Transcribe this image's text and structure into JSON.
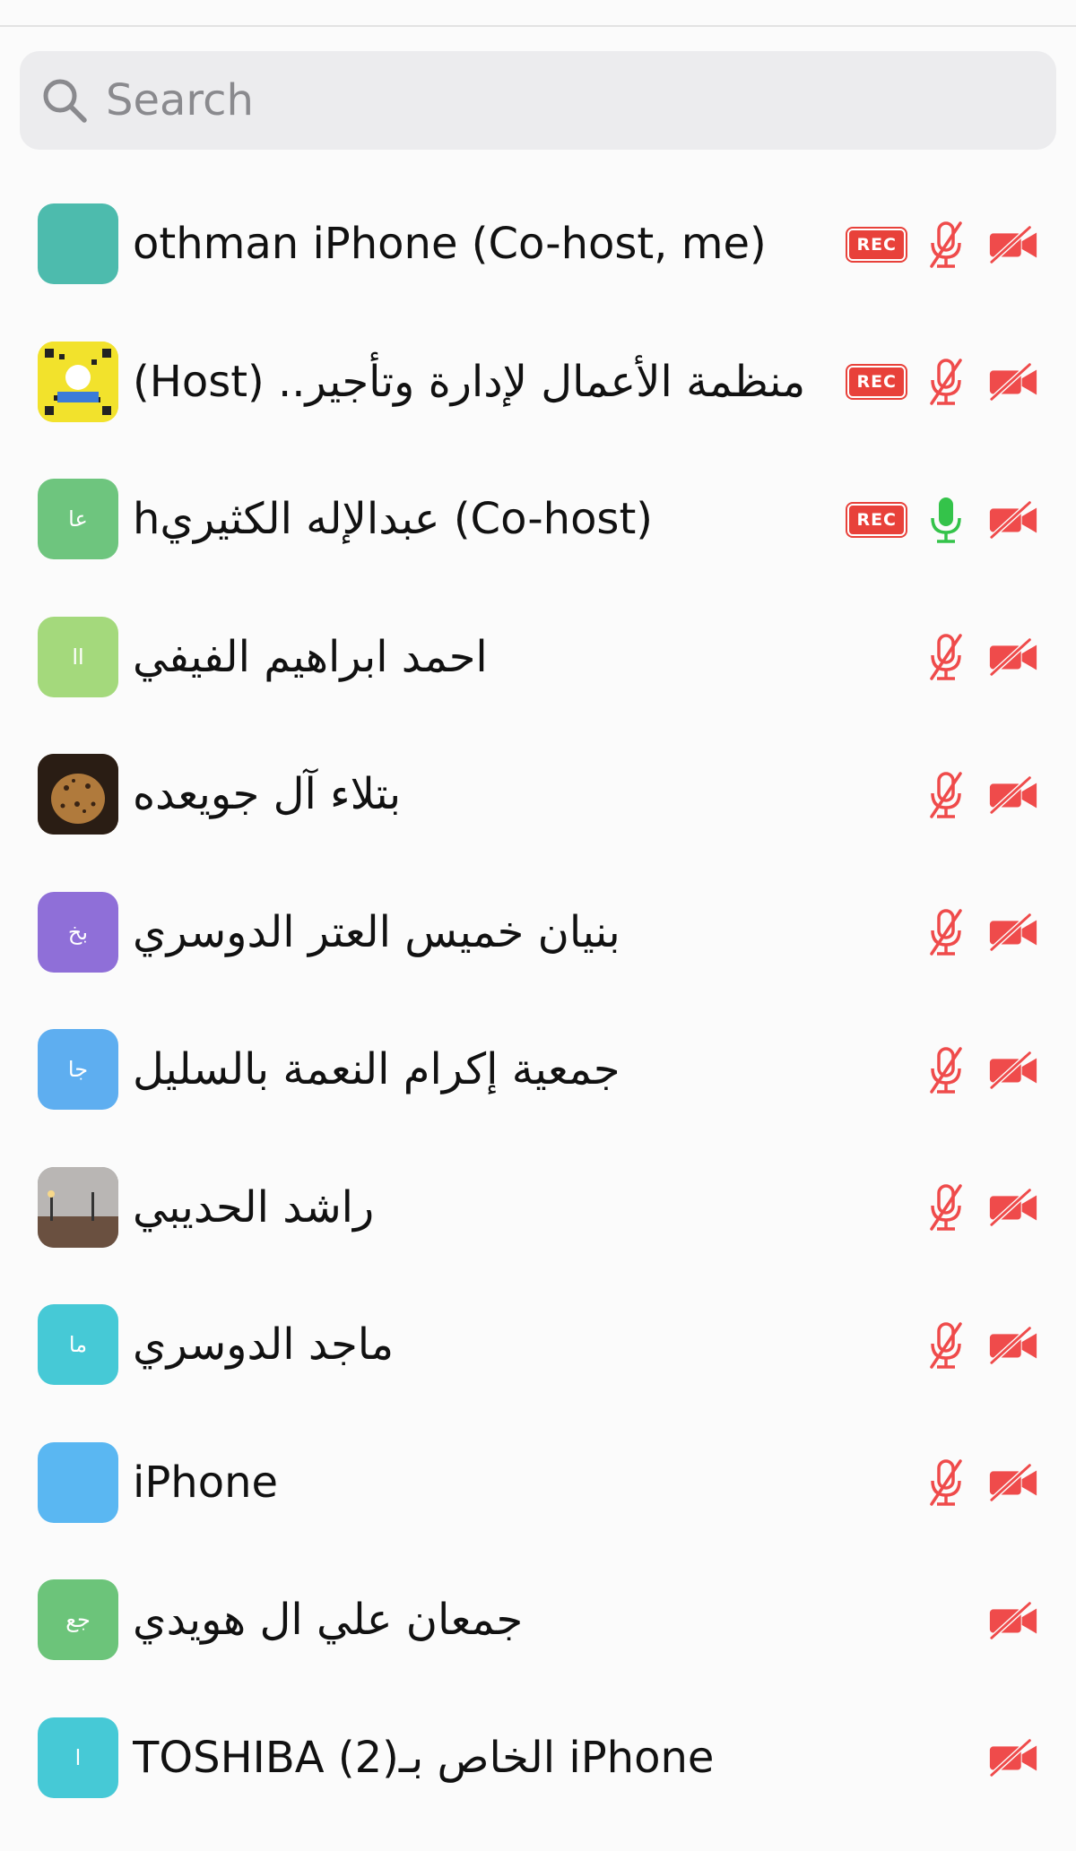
{
  "search": {
    "placeholder": "Search",
    "value": ""
  },
  "participants": [
    {
      "name": "othman iPhone (Co-host, me)",
      "avatar_text": "",
      "avatar_color": "#4dbbad",
      "rec": "REC",
      "mic": "muted",
      "video": "off"
    },
    {
      "name": "منظمة الأعمال لإدارة وتأجير.. (Host)",
      "avatar_text": "",
      "avatar_color": "#f2e22c",
      "rec": "REC",
      "mic": "muted",
      "video": "off"
    },
    {
      "name": "hعبدالإله الكثيري (Co-host)",
      "avatar_text": "عا",
      "avatar_color": "#6ec57e",
      "rec": "REC",
      "mic": "active",
      "video": "off"
    },
    {
      "name": "احمد ابراهيم الفيفي",
      "avatar_text": "اا",
      "avatar_color": "#a4d97c",
      "rec": "",
      "mic": "muted",
      "video": "off"
    },
    {
      "name": "بتلاء آل جويعده",
      "avatar_text": "",
      "avatar_color": "#6b4a2a",
      "rec": "",
      "mic": "muted",
      "video": "off"
    },
    {
      "name": "بنيان خميس العتر الدوسري",
      "avatar_text": "بخ",
      "avatar_color": "#8f6fd8",
      "rec": "",
      "mic": "muted",
      "video": "off"
    },
    {
      "name": "جمعية إكرام النعمة بالسليل",
      "avatar_text": "جا",
      "avatar_color": "#5eaef0",
      "rec": "",
      "mic": "muted",
      "video": "off"
    },
    {
      "name": "راشد الحديبي",
      "avatar_text": "",
      "avatar_color": "#8c8e8e",
      "rec": "",
      "mic": "muted",
      "video": "off"
    },
    {
      "name": "ماجد الدوسري",
      "avatar_text": "ما",
      "avatar_color": "#46c9d6",
      "rec": "",
      "mic": "muted",
      "video": "off"
    },
    {
      "name": "iPhone",
      "avatar_text": "",
      "avatar_color": "#5ab7f2",
      "rec": "",
      "mic": "muted",
      "video": "off"
    },
    {
      "name": "جمعان علي ال هويدي",
      "avatar_text": "جع",
      "avatar_color": "#6cc47a",
      "rec": "",
      "mic": "none",
      "video": "off"
    },
    {
      "name": "TOSHIBA (2)الخاص بـ iPhone",
      "avatar_text": "ا",
      "avatar_color": "#46c9d6",
      "rec": "",
      "mic": "none",
      "video": "off"
    }
  ]
}
